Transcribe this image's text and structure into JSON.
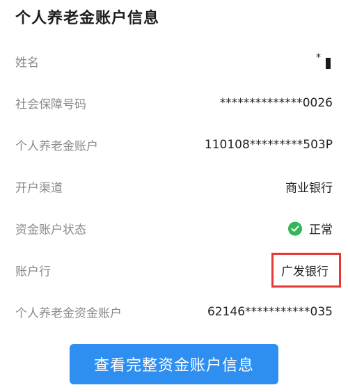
{
  "page_title": "个人养老金账户信息",
  "rows": [
    {
      "label": "姓名",
      "value": "*"
    },
    {
      "label": "社会保障号码",
      "value": "**************0026"
    },
    {
      "label": "个人养老金账户",
      "value": "110108*********503P"
    },
    {
      "label": "开户渠道",
      "value": "商业银行"
    },
    {
      "label": "资金账户状态",
      "value": "正常"
    },
    {
      "label": "账户行",
      "value": "广发银行"
    },
    {
      "label": "个人养老金资金账户",
      "value": "62146***********035"
    }
  ],
  "button": {
    "label": "查看完整资金账户信息"
  },
  "icons": {
    "status": "check-circle-icon"
  },
  "colors": {
    "accent": "#2f8ff0",
    "status_ok": "#34b55a",
    "highlight": "#e53935",
    "label": "#8a8a8a"
  }
}
